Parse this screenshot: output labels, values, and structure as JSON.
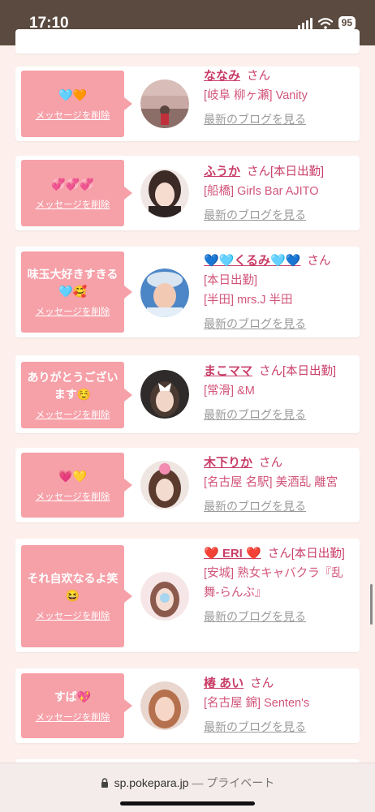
{
  "status_bar": {
    "time": "17:10",
    "battery": "95"
  },
  "cards": [
    {
      "message": "🩵🧡",
      "delete": "メッセージを削除",
      "name": "ななみ",
      "suffix": "さん",
      "details": [
        "[岐阜 柳ヶ瀬] Vanity"
      ],
      "blog": "最新のブログを見る"
    },
    {
      "message": "💞💞💞",
      "delete": "メッセージを削除",
      "name": "ふうか",
      "suffix": "さん[本日出勤]",
      "details": [
        "[船橋] Girls Bar AJITO"
      ],
      "blog": "最新のブログを見る"
    },
    {
      "message": "味玉大好きすきる🩵🥰",
      "delete": "メッセージを削除",
      "name": "💙🩵くるみ🩵💙",
      "suffix": "さん",
      "details": [
        "[本日出勤]",
        "[半田] mrs.J 半田"
      ],
      "blog": "最新のブログを見る"
    },
    {
      "message": "ありがとうございます☺️",
      "delete": "メッセージを削除",
      "name": "まこママ",
      "suffix": "さん[本日出勤]",
      "details": [
        "[常滑] &M"
      ],
      "blog": "最新のブログを見る"
    },
    {
      "message": "💗💛",
      "delete": "メッセージを削除",
      "name": "木下りか",
      "suffix": "さん",
      "details": [
        "[名古屋 名駅] 美酒乱 離宮"
      ],
      "blog": "最新のブログを見る"
    },
    {
      "message": "それ自欢なるよ笑😆",
      "delete": "メッセージを削除",
      "name": "❤️ ERI ❤️",
      "suffix": "さん[本日出勤]",
      "details": [
        "[安城] 熟女キャバクラ『乱舞-らんぶ』"
      ],
      "blog": "最新のブログを見る"
    },
    {
      "message": "すば💖",
      "delete": "メッセージを削除",
      "name": "椿 あい",
      "suffix": "さん",
      "details": [
        "[名古屋 錦] Senten's"
      ],
      "blog": "最新のブログを見る"
    }
  ],
  "browser": {
    "domain": "sp.pokepara.jp",
    "separator": "—",
    "mode": "プライベート"
  }
}
